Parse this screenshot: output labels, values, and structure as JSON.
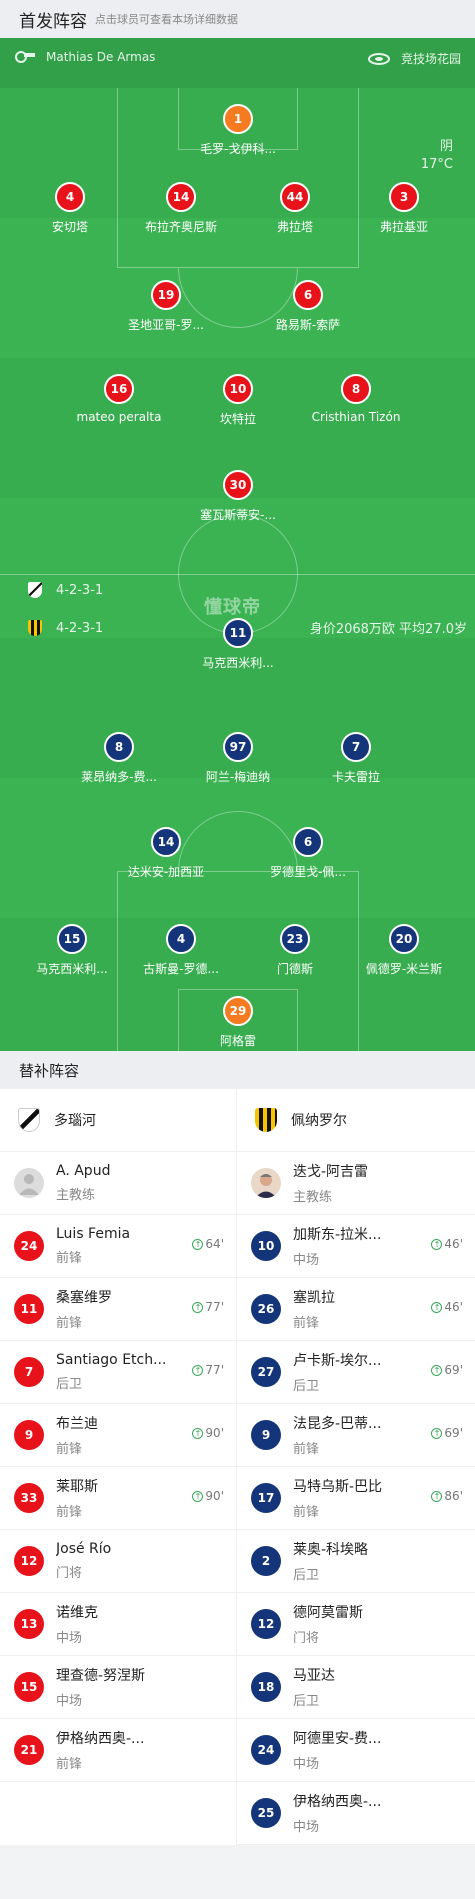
{
  "header": {
    "title": "首发阵容",
    "hint": "点击球员可查看本场详细数据"
  },
  "match": {
    "referee": "Mathias De Armas",
    "venue": "竞技场花园",
    "weather": "阴",
    "temperature": "17°C"
  },
  "home": {
    "name": "多瑙河",
    "formation": "4-2-3-1",
    "color": "#e8121b",
    "players": [
      {
        "num": "1",
        "name": "毛罗-戈伊科...",
        "gk": true
      },
      {
        "num": "4",
        "name": "安切塔"
      },
      {
        "num": "14",
        "name": "布拉齐奥尼斯",
        "yellow": true
      },
      {
        "num": "44",
        "name": "弗拉塔"
      },
      {
        "num": "3",
        "name": "弗拉基亚",
        "sub": "77'"
      },
      {
        "num": "19",
        "name": "圣地亚哥-罗...",
        "red": true
      },
      {
        "num": "6",
        "name": "路易斯-索萨",
        "yellow": true,
        "sub": "64'"
      },
      {
        "num": "16",
        "name": "mateo peralta"
      },
      {
        "num": "10",
        "name": "坎特拉",
        "sub": "90'"
      },
      {
        "num": "8",
        "name": "Cristhian Tizón",
        "sub": "90'"
      },
      {
        "num": "30",
        "name": "塞瓦斯蒂安-...",
        "sub": "77'"
      }
    ]
  },
  "away": {
    "name": "佩纳罗尔",
    "formation": "4-2-3-1",
    "color": "#15357a",
    "value_text": "身价2068万欧 平均27.0岁",
    "players": [
      {
        "num": "11",
        "name": "马克西米利...",
        "sub": "86'"
      },
      {
        "num": "8",
        "name": "莱昂纳多-费...",
        "goal": true
      },
      {
        "num": "97",
        "name": "阿兰-梅迪纳",
        "sub": "46'"
      },
      {
        "num": "7",
        "name": "卡夫雷拉",
        "sub": "69'"
      },
      {
        "num": "14",
        "name": "达米安-加西亚",
        "sub": "46'"
      },
      {
        "num": "6",
        "name": "罗德里戈-佩..."
      },
      {
        "num": "15",
        "name": "马克西米利...",
        "sub": "69'"
      },
      {
        "num": "4",
        "name": "古斯曼-罗德...",
        "yellow": true
      },
      {
        "num": "23",
        "name": "门德斯"
      },
      {
        "num": "20",
        "name": "佩德罗-米兰斯"
      },
      {
        "num": "29",
        "name": "阿格雷",
        "gk": true
      }
    ]
  },
  "watermark": "懂球帝",
  "bench": {
    "title": "替补阵容",
    "home": {
      "coach": {
        "name": "A. Apud",
        "role": "主教练"
      },
      "subs": [
        {
          "num": "24",
          "name": "Luis Femia",
          "pos": "前锋",
          "time": "64'"
        },
        {
          "num": "11",
          "name": "桑塞维罗",
          "pos": "前锋",
          "time": "77'"
        },
        {
          "num": "7",
          "name": "Santiago Etch...",
          "pos": "后卫",
          "time": "77'"
        },
        {
          "num": "9",
          "name": "布兰迪",
          "pos": "前锋",
          "time": "90'"
        },
        {
          "num": "33",
          "name": "莱耶斯",
          "pos": "前锋",
          "time": "90'"
        },
        {
          "num": "12",
          "name": "José Río",
          "pos": "门将",
          "time": ""
        },
        {
          "num": "13",
          "name": "诺维克",
          "pos": "中场",
          "time": ""
        },
        {
          "num": "15",
          "name": "理查德-努涅斯",
          "pos": "中场",
          "time": ""
        },
        {
          "num": "21",
          "name": "伊格纳西奥-...",
          "pos": "前锋",
          "time": ""
        }
      ]
    },
    "away": {
      "coach": {
        "name": "迭戈-阿吉雷",
        "role": "主教练"
      },
      "subs": [
        {
          "num": "10",
          "name": "加斯东-拉米...",
          "pos": "中场",
          "time": "46'"
        },
        {
          "num": "26",
          "name": "塞凯拉",
          "pos": "前锋",
          "time": "46'"
        },
        {
          "num": "27",
          "name": "卢卡斯-埃尔...",
          "pos": "后卫",
          "time": "69'"
        },
        {
          "num": "9",
          "name": "法昆多-巴蒂...",
          "pos": "前锋",
          "time": "69'"
        },
        {
          "num": "17",
          "name": "马特乌斯-巴比",
          "pos": "前锋",
          "time": "86'"
        },
        {
          "num": "2",
          "name": "莱奥-科埃略",
          "pos": "后卫",
          "time": ""
        },
        {
          "num": "12",
          "name": "德阿莫雷斯",
          "pos": "门将",
          "time": ""
        },
        {
          "num": "18",
          "name": "马亚达",
          "pos": "后卫",
          "time": ""
        },
        {
          "num": "24",
          "name": "阿德里安-费...",
          "pos": "中场",
          "time": ""
        },
        {
          "num": "25",
          "name": "伊格纳西奥-...",
          "pos": "中场",
          "time": ""
        }
      ]
    }
  }
}
